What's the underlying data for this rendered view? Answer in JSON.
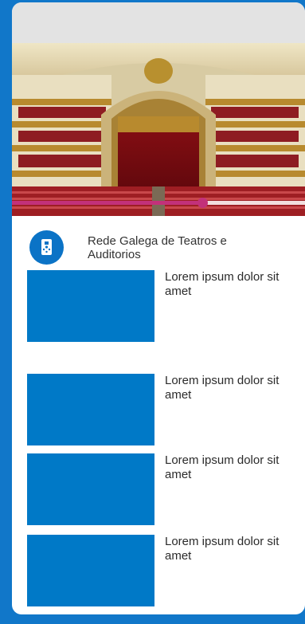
{
  "colors": {
    "background": "#1177c9",
    "accent": "#c2317a",
    "thumbnail": "#0079c7",
    "header": "#e3e3e3"
  },
  "hero": {
    "image": "theatre-interior-icon",
    "progress": 0.65
  },
  "organization": {
    "logo_icon": "galicia-coat-of-arms-icon",
    "name": "Rede Galega de Teatros e Auditorios"
  },
  "list": [
    {
      "thumb_icon": "thumbnail-placeholder",
      "title": "Lorem ipsum dolor sit amet"
    },
    {
      "thumb_icon": "thumbnail-placeholder",
      "title": "Lorem ipsum dolor sit amet"
    },
    {
      "thumb_icon": "thumbnail-placeholder",
      "title": "Lorem ipsum dolor sit amet"
    },
    {
      "thumb_icon": "thumbnail-placeholder",
      "title": "Lorem ipsum dolor sit amet"
    }
  ]
}
